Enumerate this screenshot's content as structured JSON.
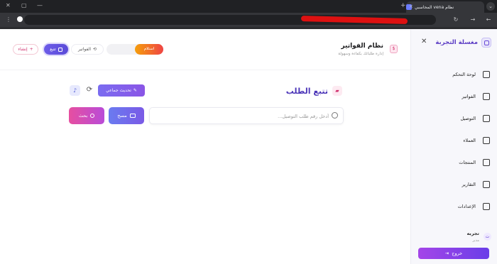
{
  "browser": {
    "tab_title": "نظام vena المحاسبي",
    "tab_close": "×",
    "tab_search": "⌄",
    "new_tab": "+",
    "win_min": "—",
    "win_restore": "▢",
    "win_close": "✕"
  },
  "sidebar": {
    "title": "مغسلة التجربة",
    "close": "✕",
    "items": [
      {
        "label": "لوحة التحكم",
        "icon": "home-icon"
      },
      {
        "label": "الفواتير",
        "icon": "file-icon"
      },
      {
        "label": "التوصيل",
        "icon": "truck-icon"
      },
      {
        "label": "العملاء",
        "icon": "users-icon"
      },
      {
        "label": "المنتجات",
        "icon": "cubes-icon"
      },
      {
        "label": "التقارير",
        "icon": "chart-icon"
      },
      {
        "label": "الإعدادات",
        "icon": "gear-icon"
      }
    ],
    "user": {
      "name": "تجربه",
      "role": "مدير",
      "avatar": "ت"
    },
    "logout": "خروج"
  },
  "header": {
    "title": "نظام الفواتير",
    "subtitle": "إدارة طلباتك بكفاءة وسهولة",
    "status": "استلام",
    "invoices": "الفواتير",
    "track": "تتبع",
    "create": "إنشاء"
  },
  "main": {
    "title": "تتبع الطلب",
    "bulk_update": "تحديث جماعي",
    "search_placeholder": "أدخل رقم طلب التوصيل...",
    "scan": "مسح",
    "search": "بحث"
  }
}
